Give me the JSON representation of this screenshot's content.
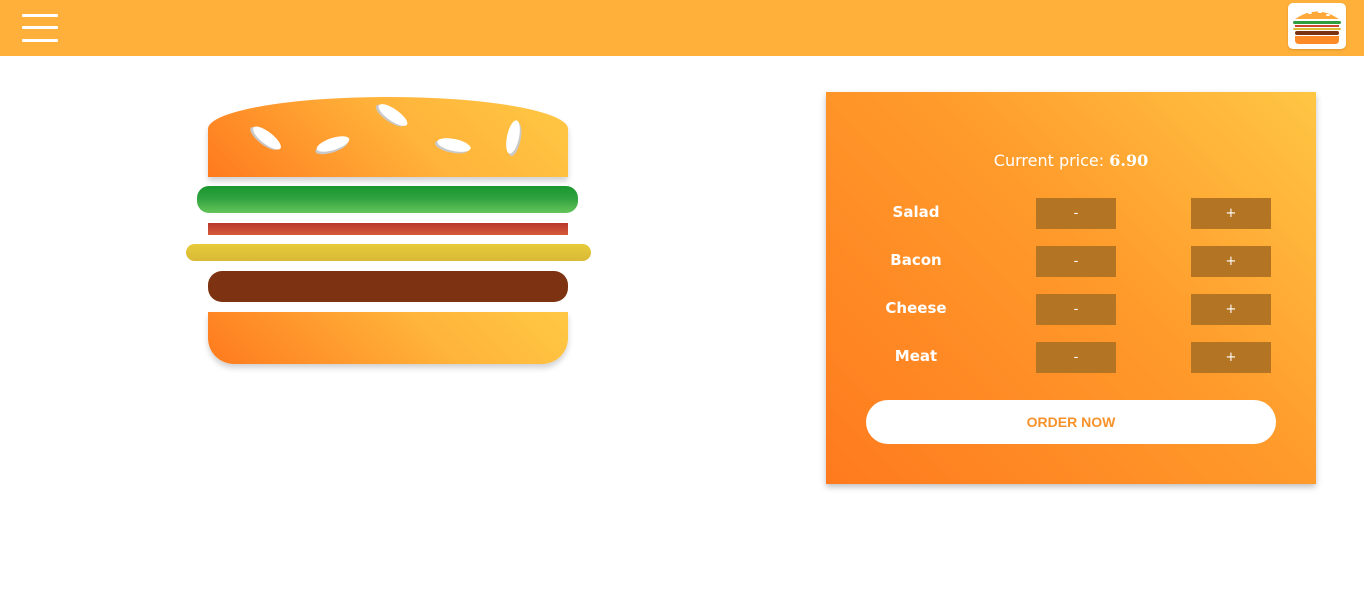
{
  "header": {
    "menu_icon": "hamburger-menu-icon",
    "logo_icon": "burger-logo-icon"
  },
  "burger": {
    "layers": [
      "bread-top",
      "salad",
      "bacon",
      "cheese",
      "meat",
      "bread-bottom"
    ]
  },
  "controls": {
    "price_label": "Current price:",
    "price_value": "6.90",
    "less_label": "-",
    "more_label": "+",
    "ingredients": [
      {
        "label": "Salad"
      },
      {
        "label": "Bacon"
      },
      {
        "label": "Cheese"
      },
      {
        "label": "Meat"
      }
    ],
    "order_label": "ORDER NOW"
  },
  "colors": {
    "topbar": "#ffb03a",
    "panel_start": "#ff7a1e",
    "panel_end": "#ffc644",
    "button": "#b37524",
    "order_text": "#f7922b"
  }
}
